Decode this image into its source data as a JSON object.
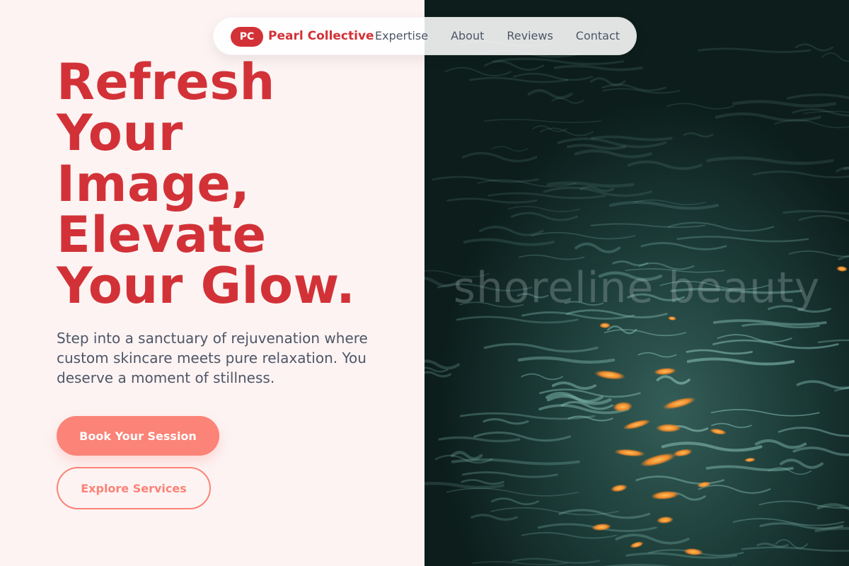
{
  "nav": {
    "brand_badge": "PC",
    "brand_name": "Pearl Collective",
    "links": [
      "Expertise",
      "About",
      "Reviews",
      "Contact"
    ]
  },
  "hero": {
    "title_lines": [
      "Refresh",
      "Your",
      "Image,",
      "Elevate",
      "Your Glow."
    ],
    "description": "Step into a sanctuary of rejuvenation where custom skincare meets pure relaxation. You deserve a moment of stillness.",
    "primary_button": "Book Your Session",
    "secondary_button": "Explore Services"
  },
  "image": {
    "watermark": "shoreline beauty"
  },
  "colors": {
    "accent": "#d23237",
    "button": "#fb8377",
    "background": "#fdf3f3",
    "body_text": "#4e5666",
    "water_dark": "#0f2422",
    "water_highlight": "#7fb5ad",
    "reflection": "#f7a240"
  }
}
